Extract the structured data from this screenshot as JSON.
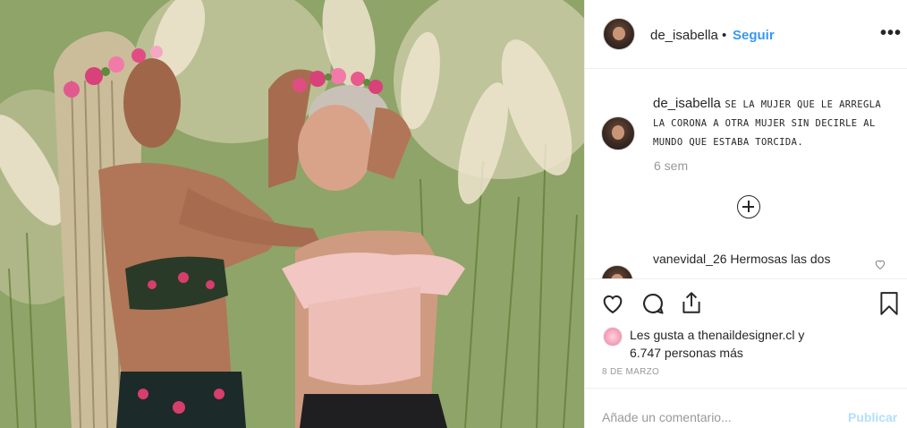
{
  "post": {
    "username": "de_isabella",
    "separator": "•",
    "follow_label": "Seguir",
    "more_label": "•••"
  },
  "caption": {
    "username": "de_isabella",
    "text": "SE LA MUJER QUE LE ARREGLA LA CORONA A OTRA MUJER SIN DECIRLE AL MUNDO QUE ESTABA TORCIDA.",
    "time": "6 sem"
  },
  "comment": {
    "username": "vanevidal_26",
    "text": "Hermosas las dos"
  },
  "likes": {
    "line1": "Les gusta a thenaildesigner.cl y",
    "line2": "6.747 personas más"
  },
  "date": "8 DE MARZO",
  "add_comment": {
    "placeholder": "Añade un comentario...",
    "publish_label": "Publicar"
  },
  "icons": [
    "heart-icon",
    "comment-icon",
    "share-icon",
    "bookmark-icon",
    "add-circle-icon",
    "more-icon"
  ]
}
